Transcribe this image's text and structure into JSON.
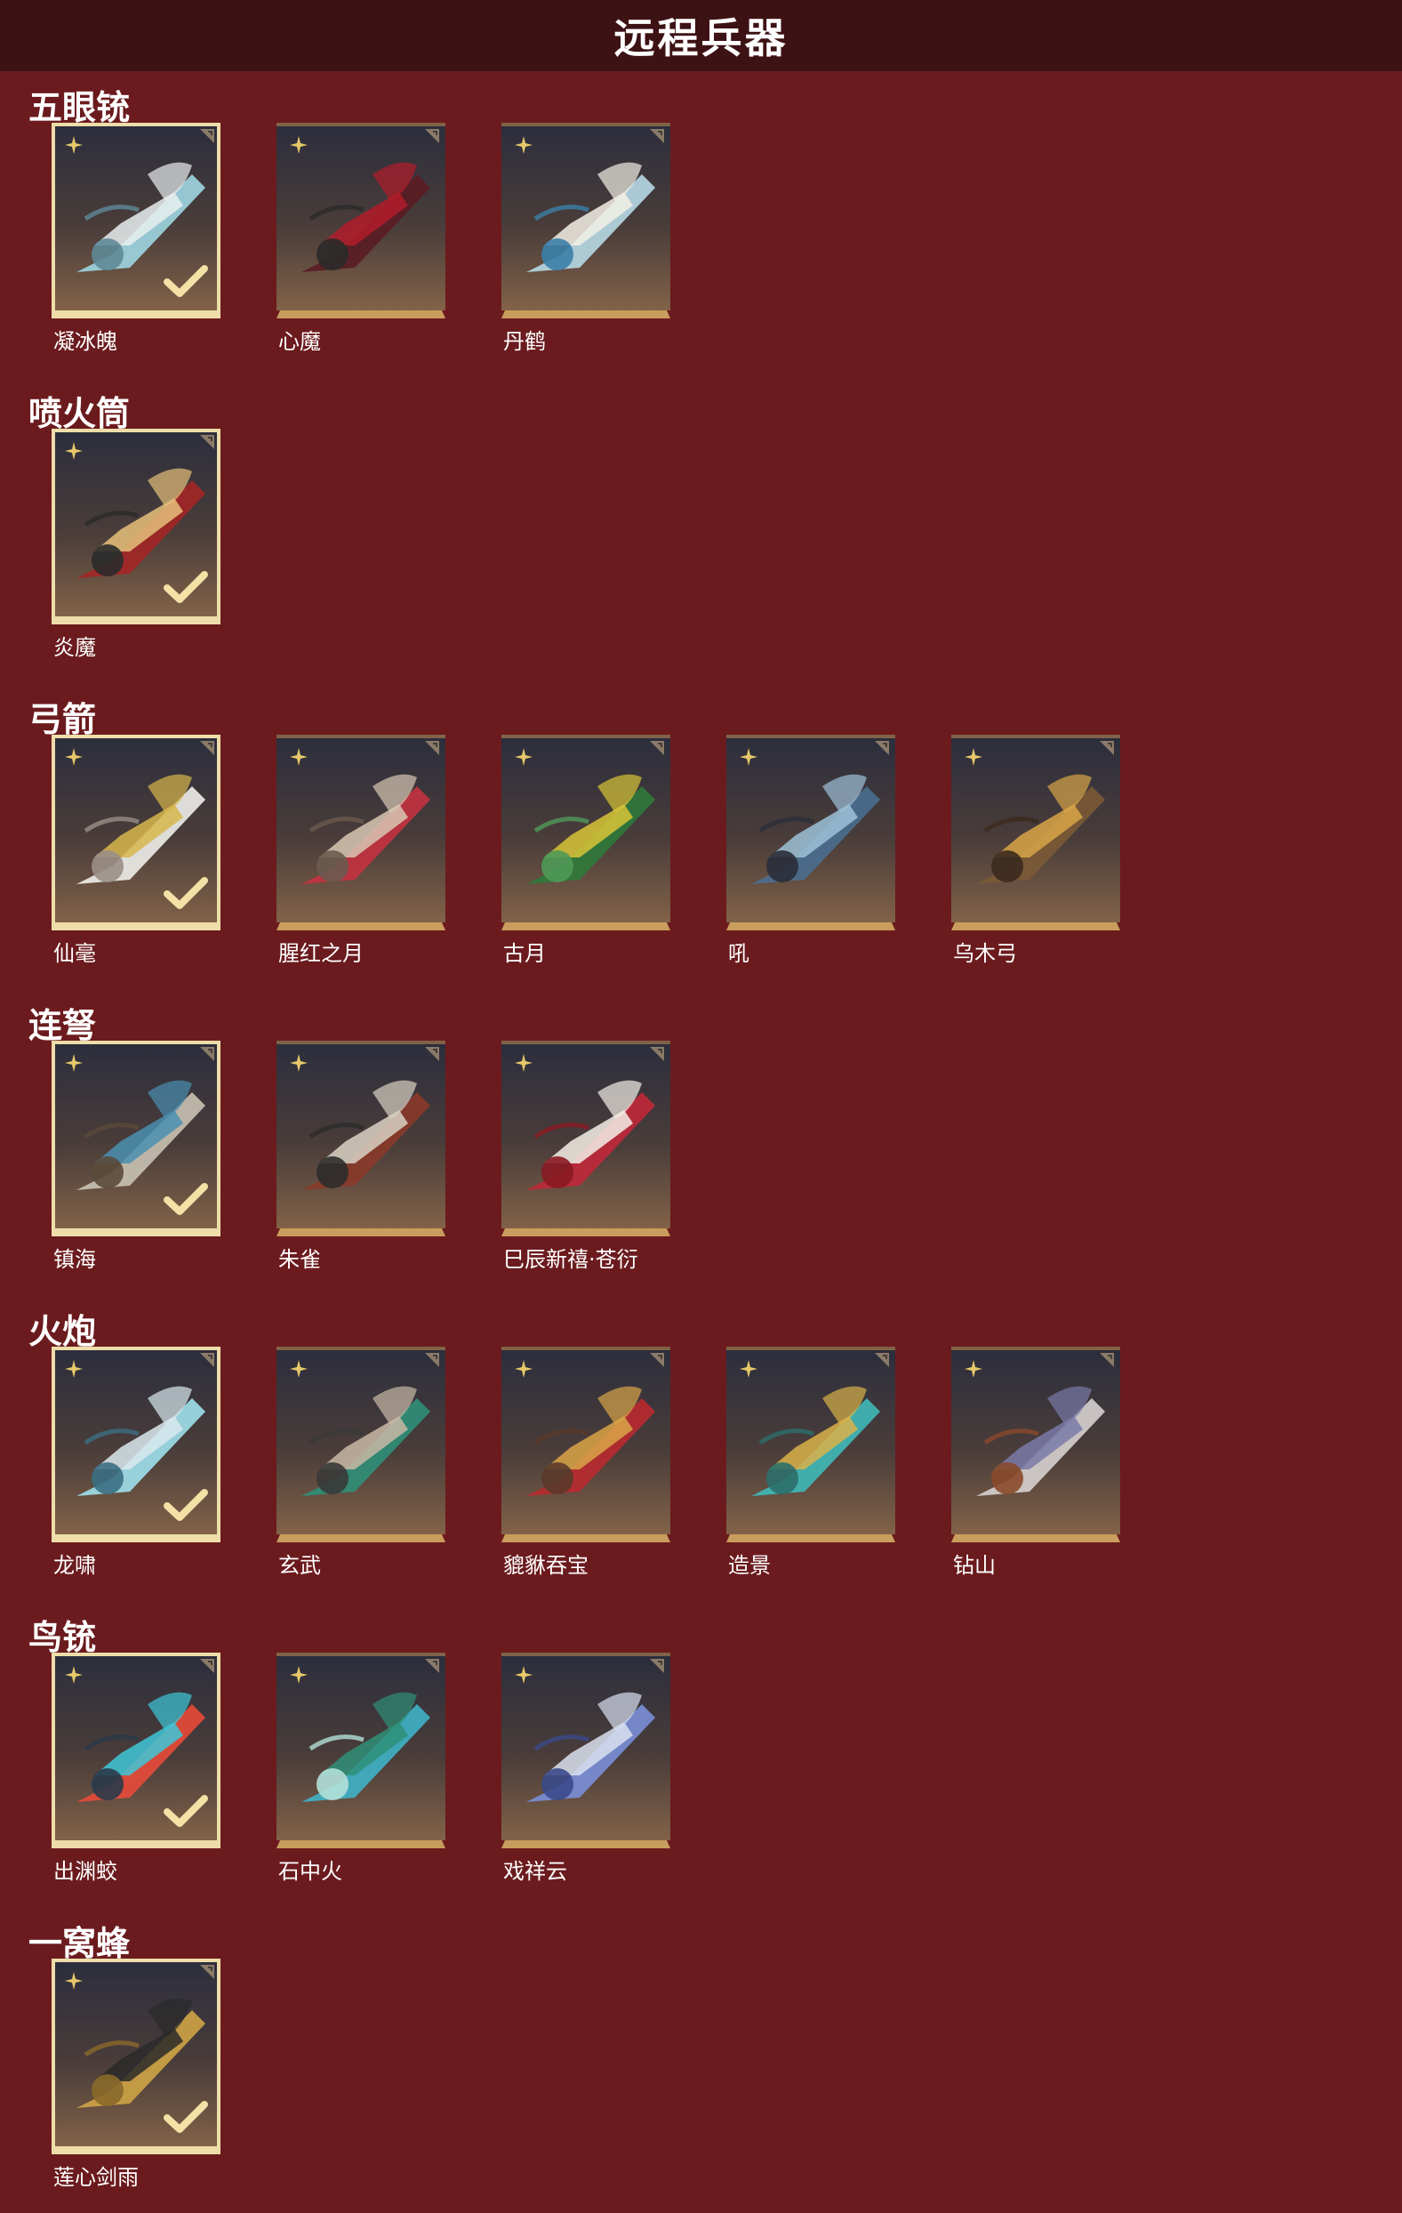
{
  "header": {
    "title": "远程兵器"
  },
  "colors": {
    "background": "#6b1b1e",
    "header": "#3d1214",
    "card_border": "#c99d5e",
    "selected_border": "#eedda9"
  },
  "sections": [
    {
      "title": "五眼铳",
      "items": [
        {
          "name": "凝冰魄",
          "selected": true,
          "icon": "ice-cannon-icon"
        },
        {
          "name": "心魔",
          "selected": false,
          "icon": "demon-cannon-icon"
        },
        {
          "name": "丹鹤",
          "selected": false,
          "icon": "crane-cannon-icon"
        }
      ]
    },
    {
      "title": "喷火筒",
      "items": [
        {
          "name": "炎魔",
          "selected": true,
          "icon": "flame-tube-icon"
        }
      ]
    },
    {
      "title": "弓箭",
      "items": [
        {
          "name": "仙毫",
          "selected": true,
          "icon": "white-bow-icon"
        },
        {
          "name": "腥红之月",
          "selected": false,
          "icon": "crimson-bow-icon"
        },
        {
          "name": "古月",
          "selected": false,
          "icon": "green-bow-icon"
        },
        {
          "name": "吼",
          "selected": false,
          "icon": "blue-bow-icon"
        },
        {
          "name": "乌木弓",
          "selected": false,
          "icon": "wood-bow-icon"
        }
      ]
    },
    {
      "title": "连弩",
      "items": [
        {
          "name": "镇海",
          "selected": true,
          "icon": "sea-crossbow-icon"
        },
        {
          "name": "朱雀",
          "selected": false,
          "icon": "vermilion-crossbow-icon"
        },
        {
          "name": "巳辰新禧·苍衍",
          "selected": false,
          "icon": "red-white-crossbow-icon"
        }
      ]
    },
    {
      "title": "火炮",
      "items": [
        {
          "name": "龙啸",
          "selected": true,
          "icon": "dragon-cannon-icon"
        },
        {
          "name": "玄武",
          "selected": false,
          "icon": "tortoise-cannon-icon"
        },
        {
          "name": "貔貅吞宝",
          "selected": false,
          "icon": "pixiu-cannon-icon"
        },
        {
          "name": "造景",
          "selected": false,
          "icon": "jade-cannon-icon"
        },
        {
          "name": "钻山",
          "selected": false,
          "icon": "drill-cannon-icon"
        }
      ]
    },
    {
      "title": "鸟铳",
      "items": [
        {
          "name": "出渊蛟",
          "selected": true,
          "icon": "serpent-musket-icon"
        },
        {
          "name": "石中火",
          "selected": false,
          "icon": "stone-musket-icon"
        },
        {
          "name": "戏祥云",
          "selected": false,
          "icon": "cloud-musket-icon"
        }
      ]
    },
    {
      "title": "一窝蜂",
      "items": [
        {
          "name": "莲心剑雨",
          "selected": true,
          "icon": "lotus-rocket-icon"
        }
      ]
    }
  ]
}
